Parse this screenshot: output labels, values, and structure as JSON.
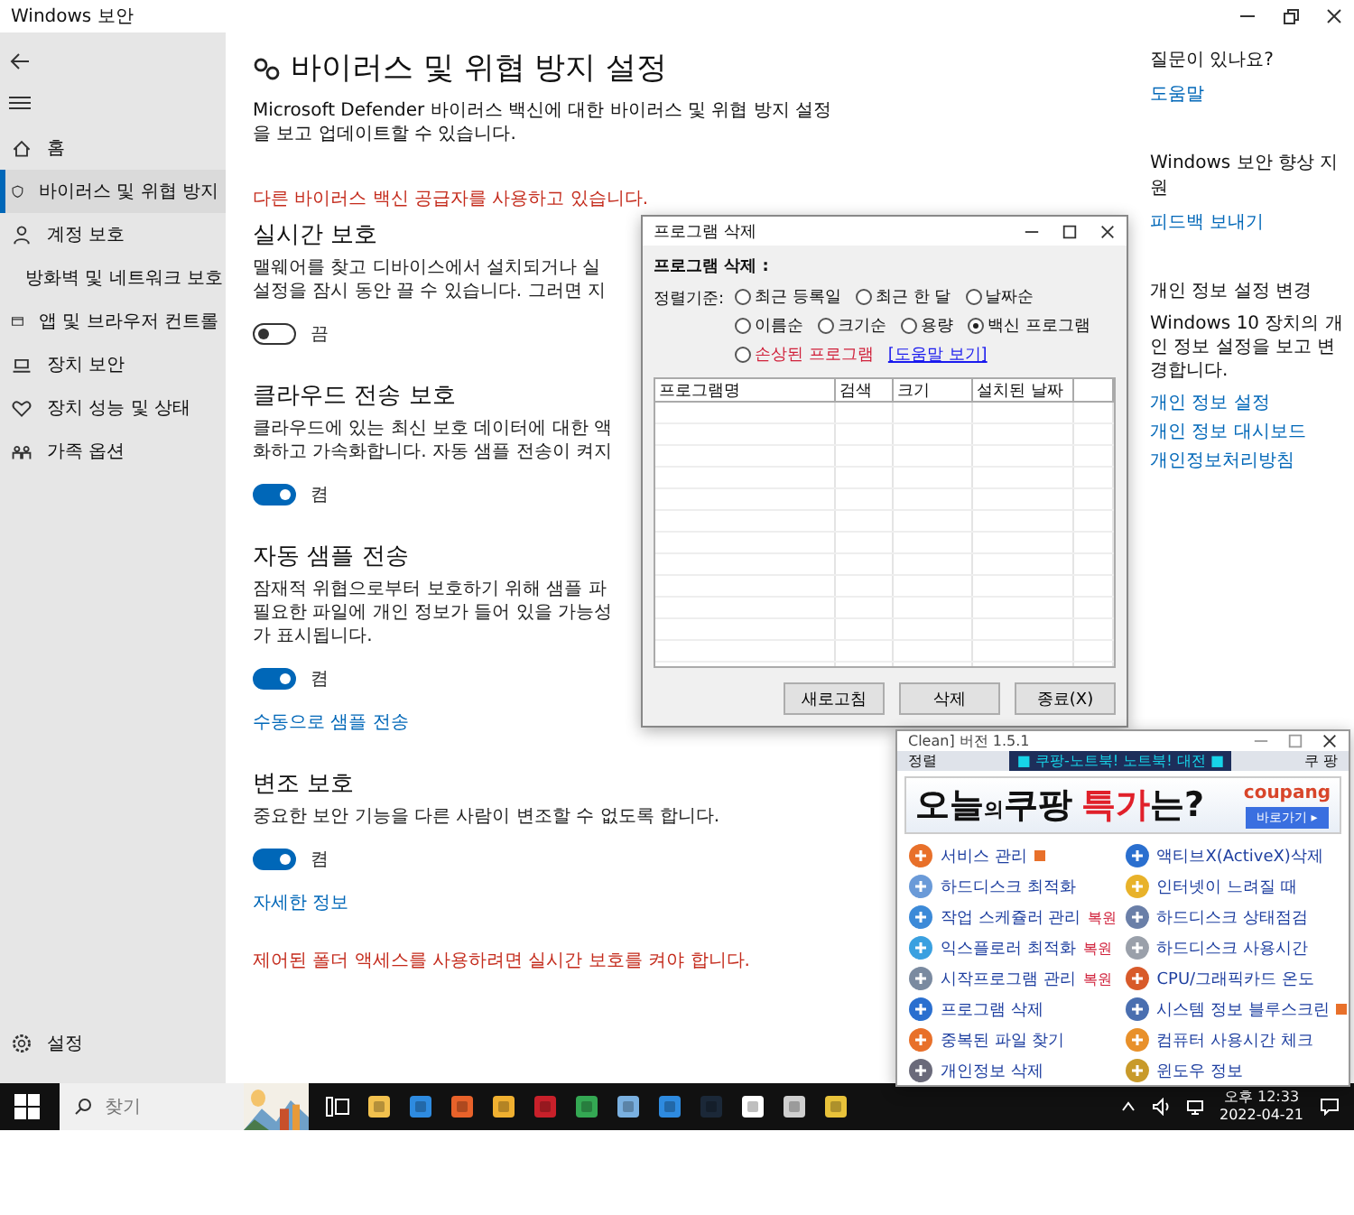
{
  "window": {
    "title": "Windows 보안"
  },
  "sidebar": {
    "items": [
      {
        "label": "홈",
        "selected": false
      },
      {
        "label": "바이러스 및 위협 방지",
        "selected": true
      },
      {
        "label": "계정 보호",
        "selected": false
      },
      {
        "label": "방화벽 및 네트워크 보호",
        "selected": false
      },
      {
        "label": "앱 및 브라우저 컨트롤",
        "selected": false
      },
      {
        "label": "장치 보안",
        "selected": false
      },
      {
        "label": "장치 성능 및 상태",
        "selected": false
      },
      {
        "label": "가족 옵션",
        "selected": false
      }
    ],
    "settings": "설정"
  },
  "main": {
    "title": "바이러스 및 위협 방지 설정",
    "description": "Microsoft Defender 바이러스 백신에 대한 바이러스 및 위협 방지 설정을 보고 업데이트할 수 있습니다.",
    "warning": "다른 바이러스 백신 공급자를 사용하고 있습니다.",
    "sections": [
      {
        "title": "실시간 보호",
        "lines": [
          "맬웨어를 찾고 디바이스에서 설치되거나 실",
          "설정을 잠시 동안 끌 수 있습니다. 그러면 지"
        ],
        "on": false,
        "state": "끔"
      },
      {
        "title": "클라우드 전송 보호",
        "lines": [
          "클라우드에 있는 최신 보호 데이터에 대한 액",
          "화하고 가속화합니다. 자동 샘플 전송이 켜지"
        ],
        "on": true,
        "state": "켬"
      },
      {
        "title": "자동 샘플 전송",
        "lines": [
          "잠재적 위협으로부터 보호하기 위해 샘플 파",
          "필요한 파일에 개인 정보가 들어 있을 가능성",
          "가 표시됩니다."
        ],
        "on": true,
        "state": "켬",
        "link": "수동으로 샘플 전송"
      },
      {
        "title": "변조 보호",
        "lines": [
          "중요한 보안 기능을 다른 사람이 변조할 수 없도록 합니다."
        ],
        "on": true,
        "state": "켬",
        "link": "자세한 정보"
      }
    ],
    "footer_warning": "제어된 폴더 액세스를 사용하려면 실시간 보호를 켜야 합니다."
  },
  "help_panel": {
    "groups": [
      {
        "heading": "질문이 있나요?",
        "links": [
          "도움말"
        ]
      },
      {
        "heading": "Windows 보안 향상 지원",
        "links": [
          "피드백 보내기"
        ]
      },
      {
        "heading": "개인 정보 설정 변경",
        "text": "Windows 10 장치의 개인 정보 설정을 보고 변경합니다.",
        "links": [
          "개인 정보 설정",
          "개인 정보 대시보드",
          "개인정보처리방침"
        ]
      }
    ]
  },
  "dialog": {
    "title": "프로그램 삭제",
    "label": "프로그램 삭제 :",
    "sort_label": "정렬기준:",
    "options": [
      {
        "label": "최근 등록일",
        "selected": false,
        "kind": "normal"
      },
      {
        "label": "최근 한 달",
        "selected": false,
        "kind": "normal"
      },
      {
        "label": "날짜순",
        "selected": false,
        "kind": "normal"
      },
      {
        "label": "이름순",
        "selected": false,
        "kind": "normal"
      },
      {
        "label": "크기순",
        "selected": false,
        "kind": "normal"
      },
      {
        "label": "용량",
        "selected": false,
        "kind": "normal"
      },
      {
        "label": "백신 프로그램",
        "selected": true,
        "kind": "normal"
      },
      {
        "label": "손상된 프로그램",
        "selected": false,
        "kind": "alert"
      }
    ],
    "help_link": "[도움말 보기]",
    "columns": [
      "프로그램명",
      "검색",
      "크기",
      "설치된 날짜"
    ],
    "buttons": [
      "새로고침",
      "삭제",
      "종료(X)"
    ]
  },
  "popup": {
    "title": "Clean] 버전 1.5.1",
    "bar_left": "정렬",
    "bar_center": "■ 쿠팡-노트북! 노트북! 대전 ■",
    "bar_right": "쿠 팡",
    "banner": {
      "parts": [
        {
          "text": "오늘",
          "kind": "big"
        },
        {
          "text": "의",
          "kind": "small"
        },
        {
          "text": "쿠팡",
          "kind": "big"
        },
        {
          "text": "특가",
          "kind": "red"
        },
        {
          "text": "는?",
          "kind": "big"
        }
      ],
      "logo": "coupang",
      "button": "바로가기 ▸"
    },
    "tools": [
      {
        "label": "서비스 관리",
        "badge": true
      },
      {
        "label": "액티브X(ActiveX)삭제",
        "badge": false
      },
      {
        "label": "하드디스크 최적화",
        "badge": false
      },
      {
        "label": "인터넷이 느려질 때",
        "badge": false
      },
      {
        "label": "작업 스케쥴러 관리",
        "tag": "복원",
        "badge": false
      },
      {
        "label": "하드디스크 상태점검",
        "badge": false
      },
      {
        "label": "익스플로러 최적화",
        "tag": "복원",
        "badge": false
      },
      {
        "label": "하드디스크 사용시간",
        "badge": false
      },
      {
        "label": "시작프로그램 관리",
        "tag": "복원",
        "badge": false
      },
      {
        "label": "CPU/그래픽카드 온도",
        "badge": false
      },
      {
        "label": "프로그램 삭제",
        "badge": false
      },
      {
        "label": "시스템 정보 블루스크린",
        "badge": true
      },
      {
        "label": "중복된 파일 찾기",
        "badge": false
      },
      {
        "label": "컴퓨터 사용시간 체크",
        "badge": false
      },
      {
        "label": "개인정보 삭제",
        "badge": false
      },
      {
        "label": "윈도우 정보",
        "badge": false
      }
    ]
  },
  "taskbar": {
    "search_placeholder": "찾기",
    "time": "오후 12:33",
    "date": "2022-04-21"
  }
}
